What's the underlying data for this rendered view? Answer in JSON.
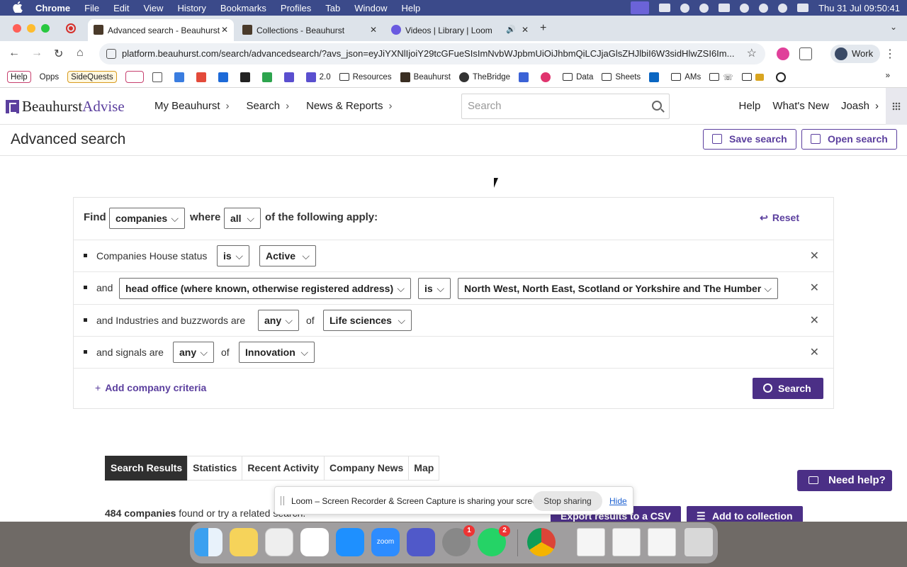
{
  "menubar": {
    "app": "Chrome",
    "items": [
      "File",
      "Edit",
      "View",
      "History",
      "Bookmarks",
      "Profiles",
      "Tab",
      "Window",
      "Help"
    ],
    "datetime": "Thu 31 Jul  09:50:41"
  },
  "tabs": [
    {
      "title": "Advanced search - Beauhurst",
      "active": true
    },
    {
      "title": "Collections - Beauhurst",
      "active": false
    },
    {
      "title": "Videos | Library | Loom",
      "active": false
    }
  ],
  "address": {
    "url": "platform.beauhurst.com/search/advancedsearch/?avs_json=eyJiYXNlIjoiY29tcGFueSIsImNvbWJpbmUiOiJhbmQiLCJjaGlsZHJlbiI6W3sidHlwZSI6Im..."
  },
  "profile": {
    "label": "Work"
  },
  "bookmarks": [
    "Help",
    "Opps",
    "SideQuests",
    "2.0",
    "Resources",
    "Beauhurst",
    "TheBridge",
    "Data",
    "Sheets",
    "AMs"
  ],
  "app": {
    "logo_a": "Beauhurst",
    "logo_b": "Advise",
    "nav": [
      "My Beauhurst",
      "Search",
      "News & Reports"
    ],
    "search_placeholder": "Search",
    "right_nav": [
      "Help",
      "What's New",
      "Joash"
    ]
  },
  "page": {
    "title": "Advanced search",
    "save_label": "Save search",
    "open_label": "Open search"
  },
  "criteria": {
    "find": "Find",
    "entity": "companies",
    "where": "where",
    "combine": "all",
    "apply": "of the following apply:",
    "reset": "Reset",
    "rows": [
      {
        "prefix": "Companies House status",
        "op": "is",
        "value": "Active"
      },
      {
        "prefix": "and",
        "field": "head office (where known, otherwise registered address)",
        "op": "is",
        "value": "North West, North East, Scotland or Yorkshire and The Humber"
      },
      {
        "prefix": "and Industries and buzzwords are",
        "op": "any",
        "of": "of",
        "value": "Life sciences"
      },
      {
        "prefix": "and signals are",
        "op": "any",
        "of": "of",
        "value": "Innovation"
      }
    ],
    "add_label": "Add company criteria",
    "search_label": "Search"
  },
  "results": {
    "tabs": [
      "Search Results",
      "Statistics",
      "Recent Activity",
      "Company News",
      "Map"
    ],
    "count": "484 companies",
    "found_text": " found or try a related search.",
    "export_label": "Export results to a CSV",
    "collection_label": "Add to collection"
  },
  "help_widget": "Need help?",
  "loom": {
    "message": "Loom – Screen Recorder & Screen Capture is sharing your screen.",
    "stop": "Stop sharing",
    "hide": "Hide"
  },
  "dock": {
    "apps": [
      "Finder",
      "Notes",
      "Launchpad",
      "Slack",
      "App Store",
      "Zoom",
      "Teams",
      "System Settings",
      "WhatsApp",
      "Chrome",
      "Preview",
      "Preview",
      "Preview",
      "Trash"
    ],
    "badges": {
      "settings": "1",
      "whatsapp": "2"
    },
    "zoom_label": "zoom"
  },
  "colors": {
    "brand": "#5b3f9e",
    "button": "#4b2f86"
  }
}
